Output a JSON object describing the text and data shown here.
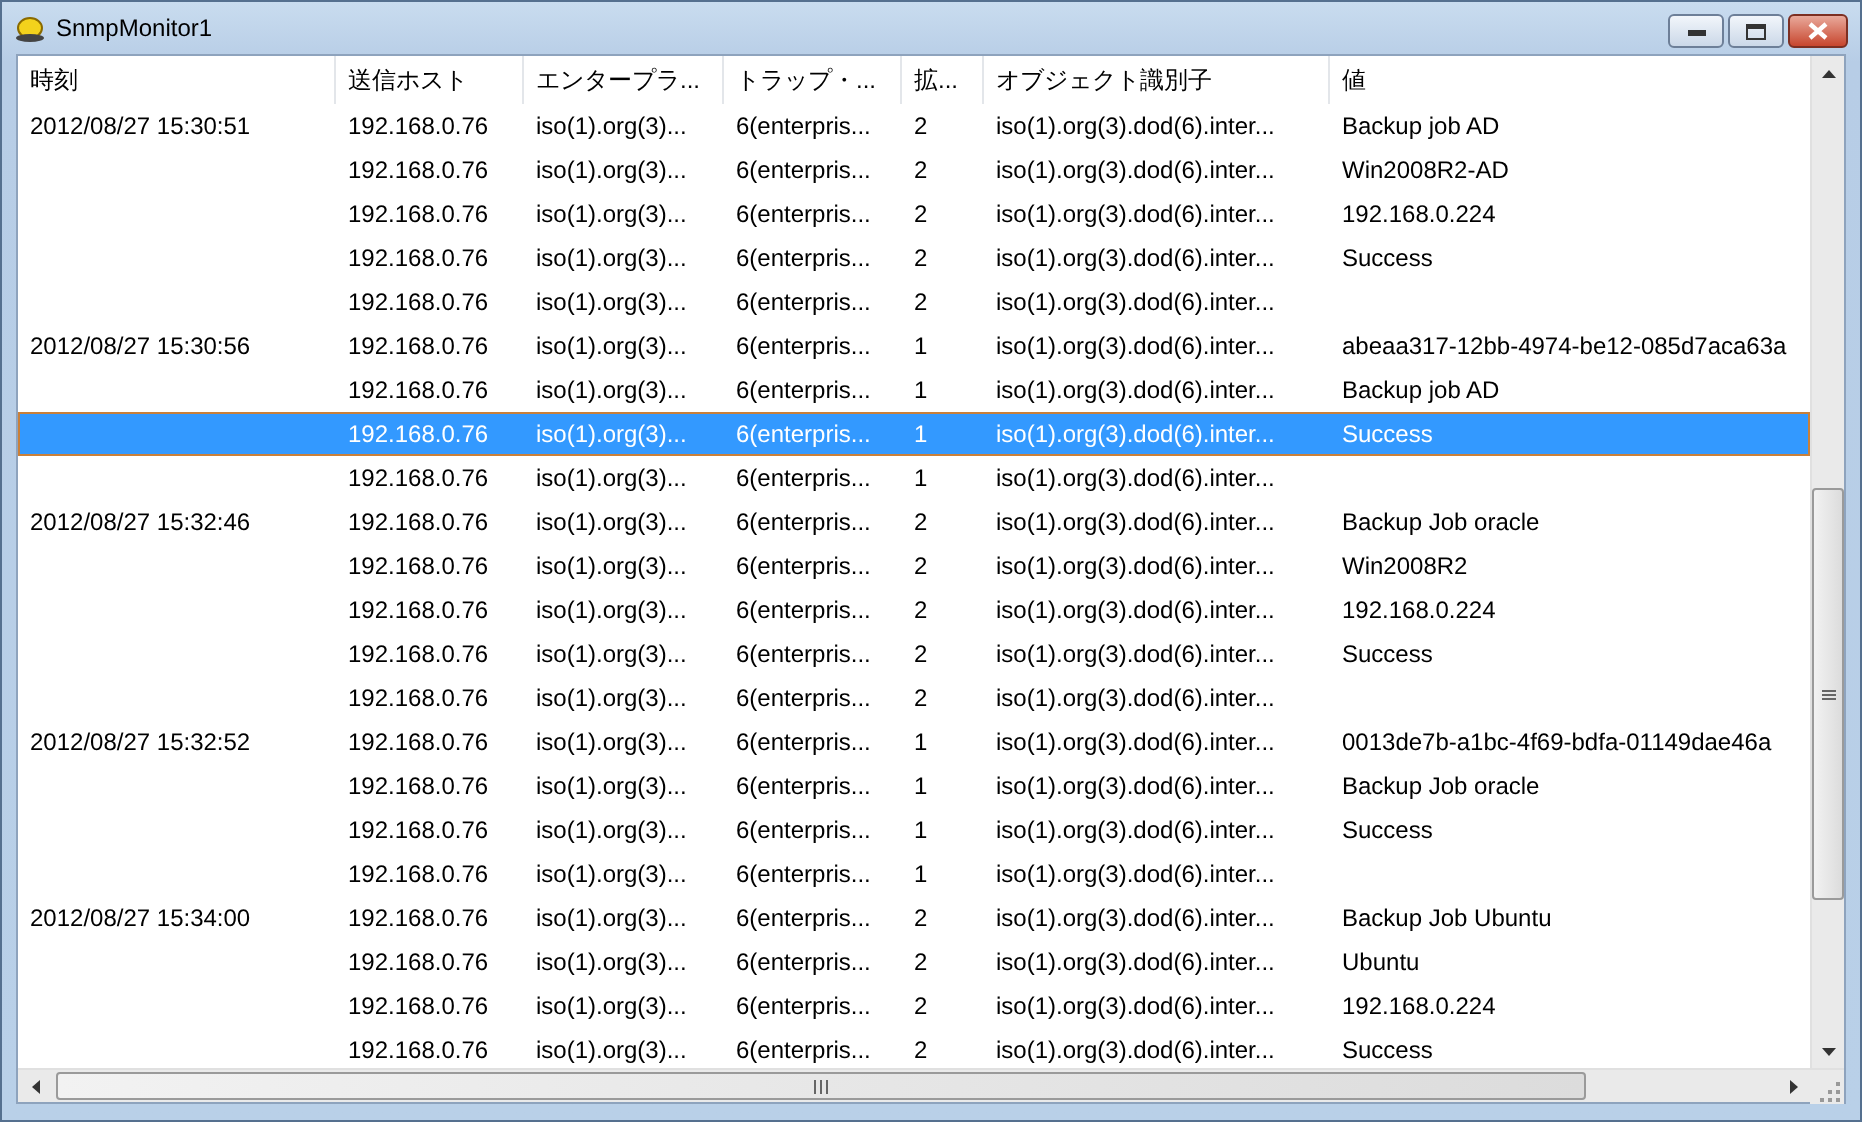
{
  "window": {
    "title": "SnmpMonitor1"
  },
  "table": {
    "columns": [
      "時刻",
      "送信ホスト",
      "エンタープラ...",
      "トラップ・...",
      "拡...",
      "オブジェクト識別子",
      "値"
    ],
    "rows": [
      {
        "time": "2012/08/27 15:30:51",
        "host": "192.168.0.76",
        "enterprise": "iso(1).org(3)...",
        "trap": "6(enterpris...",
        "ext": "2",
        "oid": "iso(1).org(3).dod(6).inter...",
        "value": "Backup job AD",
        "selected": false
      },
      {
        "host": "192.168.0.76",
        "enterprise": "iso(1).org(3)...",
        "trap": "6(enterpris...",
        "ext": "2",
        "oid": "iso(1).org(3).dod(6).inter...",
        "value": "Win2008R2-AD",
        "selected": false
      },
      {
        "host": "192.168.0.76",
        "enterprise": "iso(1).org(3)...",
        "trap": "6(enterpris...",
        "ext": "2",
        "oid": "iso(1).org(3).dod(6).inter...",
        "value": "192.168.0.224",
        "selected": false
      },
      {
        "host": "192.168.0.76",
        "enterprise": "iso(1).org(3)...",
        "trap": "6(enterpris...",
        "ext": "2",
        "oid": "iso(1).org(3).dod(6).inter...",
        "value": "Success",
        "selected": false
      },
      {
        "host": "192.168.0.76",
        "enterprise": "iso(1).org(3)...",
        "trap": "6(enterpris...",
        "ext": "2",
        "oid": "iso(1).org(3).dod(6).inter...",
        "selected": false
      },
      {
        "time": "2012/08/27 15:30:56",
        "host": "192.168.0.76",
        "enterprise": "iso(1).org(3)...",
        "trap": "6(enterpris...",
        "ext": "1",
        "oid": "iso(1).org(3).dod(6).inter...",
        "value": "abeaa317-12bb-4974-be12-085d7aca63a",
        "selected": false
      },
      {
        "host": "192.168.0.76",
        "enterprise": "iso(1).org(3)...",
        "trap": "6(enterpris...",
        "ext": "1",
        "oid": "iso(1).org(3).dod(6).inter...",
        "value": "Backup job AD",
        "selected": false
      },
      {
        "host": "192.168.0.76",
        "enterprise": "iso(1).org(3)...",
        "trap": "6(enterpris...",
        "ext": "1",
        "oid": "iso(1).org(3).dod(6).inter...",
        "value": "Success",
        "selected": true
      },
      {
        "host": "192.168.0.76",
        "enterprise": "iso(1).org(3)...",
        "trap": "6(enterpris...",
        "ext": "1",
        "oid": "iso(1).org(3).dod(6).inter...",
        "selected": false
      },
      {
        "time": "2012/08/27 15:32:46",
        "host": "192.168.0.76",
        "enterprise": "iso(1).org(3)...",
        "trap": "6(enterpris...",
        "ext": "2",
        "oid": "iso(1).org(3).dod(6).inter...",
        "value": "Backup Job oracle",
        "selected": false
      },
      {
        "host": "192.168.0.76",
        "enterprise": "iso(1).org(3)...",
        "trap": "6(enterpris...",
        "ext": "2",
        "oid": "iso(1).org(3).dod(6).inter...",
        "value": "Win2008R2",
        "selected": false
      },
      {
        "host": "192.168.0.76",
        "enterprise": "iso(1).org(3)...",
        "trap": "6(enterpris...",
        "ext": "2",
        "oid": "iso(1).org(3).dod(6).inter...",
        "value": "192.168.0.224",
        "selected": false
      },
      {
        "host": "192.168.0.76",
        "enterprise": "iso(1).org(3)...",
        "trap": "6(enterpris...",
        "ext": "2",
        "oid": "iso(1).org(3).dod(6).inter...",
        "value": "Success",
        "selected": false
      },
      {
        "host": "192.168.0.76",
        "enterprise": "iso(1).org(3)...",
        "trap": "6(enterpris...",
        "ext": "2",
        "oid": "iso(1).org(3).dod(6).inter...",
        "selected": false
      },
      {
        "time": "2012/08/27 15:32:52",
        "host": "192.168.0.76",
        "enterprise": "iso(1).org(3)...",
        "trap": "6(enterpris...",
        "ext": "1",
        "oid": "iso(1).org(3).dod(6).inter...",
        "value": "0013de7b-a1bc-4f69-bdfa-01149dae46a",
        "selected": false
      },
      {
        "host": "192.168.0.76",
        "enterprise": "iso(1).org(3)...",
        "trap": "6(enterpris...",
        "ext": "1",
        "oid": "iso(1).org(3).dod(6).inter...",
        "value": "Backup Job oracle",
        "selected": false
      },
      {
        "host": "192.168.0.76",
        "enterprise": "iso(1).org(3)...",
        "trap": "6(enterpris...",
        "ext": "1",
        "oid": "iso(1).org(3).dod(6).inter...",
        "value": "Success",
        "selected": false
      },
      {
        "host": "192.168.0.76",
        "enterprise": "iso(1).org(3)...",
        "trap": "6(enterpris...",
        "ext": "1",
        "oid": "iso(1).org(3).dod(6).inter...",
        "selected": false
      },
      {
        "time": "2012/08/27 15:34:00",
        "host": "192.168.0.76",
        "enterprise": "iso(1).org(3)...",
        "trap": "6(enterpris...",
        "ext": "2",
        "oid": "iso(1).org(3).dod(6).inter...",
        "value": "Backup Job Ubuntu",
        "selected": false
      },
      {
        "host": "192.168.0.76",
        "enterprise": "iso(1).org(3)...",
        "trap": "6(enterpris...",
        "ext": "2",
        "oid": "iso(1).org(3).dod(6).inter...",
        "value": "Ubuntu",
        "selected": false
      },
      {
        "host": "192.168.0.76",
        "enterprise": "iso(1).org(3)...",
        "trap": "6(enterpris...",
        "ext": "2",
        "oid": "iso(1).org(3).dod(6).inter...",
        "value": "192.168.0.224",
        "selected": false
      },
      {
        "host": "192.168.0.76",
        "enterprise": "iso(1).org(3)...",
        "trap": "6(enterpris...",
        "ext": "2",
        "oid": "iso(1).org(3).dod(6).inter...",
        "value": "Success",
        "selected": false
      }
    ]
  }
}
